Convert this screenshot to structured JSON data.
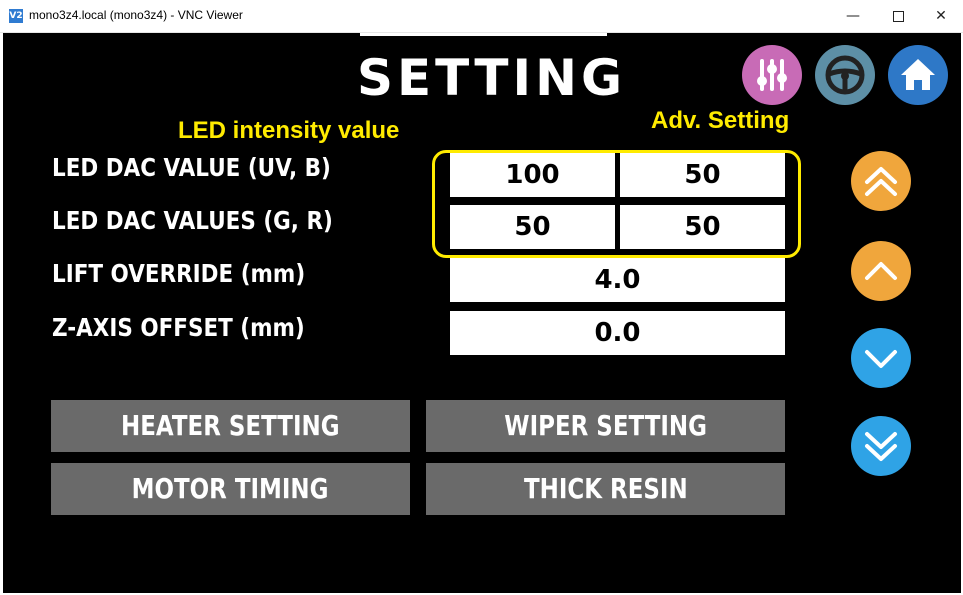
{
  "window": {
    "app_icon": "V2",
    "title": "mono3z4.local (mono3z4) - VNC Viewer",
    "minimize": "—",
    "close": "✕"
  },
  "screen": {
    "title": "SETTING",
    "annotations": {
      "led_intensity": "LED intensity value",
      "adv_setting": "Adv. Setting"
    },
    "rows": {
      "led_dac_uv_b": "LED DAC VALUE (UV, B)",
      "led_dac_g_r": "LED DAC VALUES (G, R)",
      "lift_override": "LIFT OVERRIDE (mm)",
      "z_axis_offset": "Z-AXIS OFFSET (mm)"
    },
    "values": {
      "uv": "100",
      "b": "50",
      "g": "50",
      "r": "50",
      "lift_override": "4.0",
      "z_axis_offset": "0.0"
    },
    "buttons": {
      "heater": "HEATER SETTING",
      "wiper": "WIPER SETTING",
      "motor": "MOTOR TIMING",
      "thick_resin": "THICK RESIN"
    },
    "top_icons": [
      "adv-setting-icon",
      "steering-wheel-icon",
      "home-icon"
    ],
    "nav_icons": [
      "double-chevron-up-icon",
      "chevron-up-icon",
      "chevron-down-icon",
      "double-chevron-down-icon"
    ],
    "colors": {
      "background": "#000000",
      "annotation_yellow": "#ffeb00",
      "grey_button": "#6a6a6a",
      "nav_orange": "#f0a63c",
      "nav_blue": "#2fa3e6",
      "adv_icon": "#c86bb6",
      "wheel_icon": "#5d8fa6",
      "home_icon": "#2e78c7"
    }
  }
}
